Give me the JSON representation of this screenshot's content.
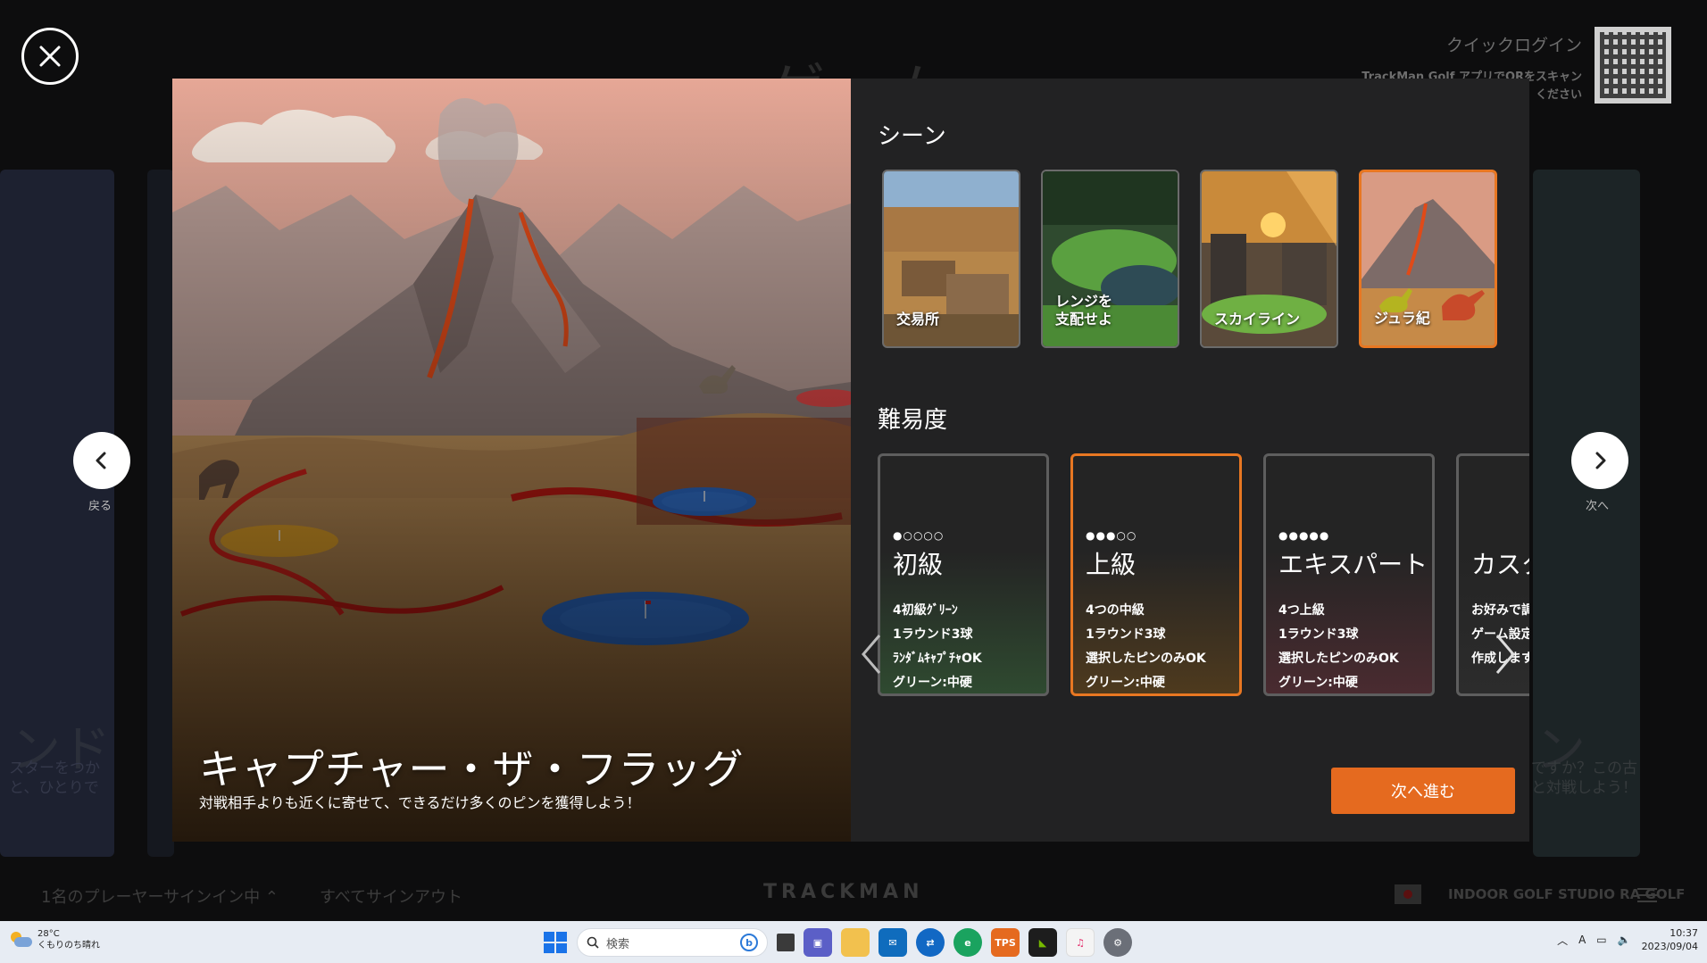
{
  "background": {
    "title": "ゲーム",
    "quick_login": {
      "title": "クイックログイン",
      "line1": "TrackMan Golf アプリでQRをスキャン",
      "line2": "ください"
    },
    "left_card": {
      "title": "ンド",
      "line1": "スターをつか",
      "line2": "と、ひとりで"
    },
    "right_card": {
      "title": "ン",
      "line1": "ですか？この古",
      "line2": "と対戦しよう！"
    },
    "prev_label": "戻る",
    "next_label": "次へ",
    "players": "1名のプレーヤーサインイン中",
    "sign_out_all": "すべてサインアウト",
    "brand": "TRACKMAN",
    "studio": "INDOOR GOLF STUDIO  RA GOLF"
  },
  "modal": {
    "game_title": "キャプチャー・ザ・フラッグ",
    "game_subtitle": "対戦相手よりも近くに寄せて、できるだけ多くのピンを獲得しよう！",
    "scene_heading": "シーン",
    "scenes": [
      {
        "label": "交易所",
        "selected": false
      },
      {
        "label": "レンジを\n支配せよ",
        "selected": false
      },
      {
        "label": "スカイライン",
        "selected": false
      },
      {
        "label": "ジュラ紀",
        "selected": true
      }
    ],
    "difficulty_heading": "難易度",
    "difficulties": [
      {
        "dots": "●○○○○",
        "name": "初級",
        "rows": [
          "4初級ｸﾞﾘｰﾝ",
          "1ラウンド3球",
          "ﾗﾝﾀﾞﾑｷｬﾌﾟﾁｬOK",
          "グリーン:中硬"
        ],
        "selected": false
      },
      {
        "dots": "●●●○○",
        "name": "上級",
        "rows": [
          "4つの中級",
          "1ラウンド3球",
          "選択したピンのみOK",
          "グリーン:中硬"
        ],
        "selected": true
      },
      {
        "dots": "●●●●●",
        "name": "エキスパート",
        "rows": [
          "4つ上級",
          "1ラウンド3球",
          "選択したピンのみOK",
          "グリーン:中硬"
        ],
        "selected": false
      },
      {
        "dots": "",
        "name": "カスタム",
        "rows": [
          "お好みで調整",
          "ゲーム設定を",
          "作成します"
        ],
        "selected": false
      }
    ],
    "next_button": "次へ進む"
  },
  "taskbar": {
    "temperature": "28°C",
    "weather": "くもりのち晴れ",
    "search_placeholder": "検索",
    "apps": [
      "task-view",
      "teams",
      "file-explorer",
      "mail",
      "teamviewer",
      "edge",
      "tps",
      "nvidia",
      "itunes",
      "settings"
    ],
    "tps_label": "TPS",
    "time": "10:37",
    "date": "2023/09/04"
  },
  "colors": {
    "accent": "#e87722",
    "cta": "#e56a1f",
    "modal_bg": "#222223"
  }
}
